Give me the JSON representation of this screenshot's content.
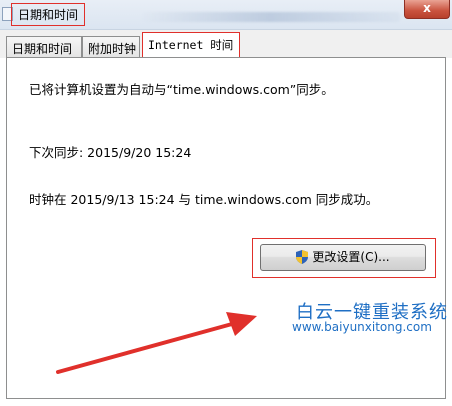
{
  "window": {
    "title": "日期和时间",
    "close_label": "x"
  },
  "tabs": [
    {
      "label": "日期和时间"
    },
    {
      "label": "附加时钟"
    },
    {
      "label": "Internet 时间"
    }
  ],
  "internet_time": {
    "set_sync_text": "已将计算机设置为自动与“time.windows.com”同步。",
    "next_sync_text": "下次同步: 2015/9/20 15:24",
    "last_sync_text": "时钟在 2015/9/13 15:24 与 time.windows.com 同步成功。",
    "change_settings_label": "更改设置(C)..."
  },
  "watermark": {
    "name": "白云一键重装系统",
    "url": "www.baiyunxitong.com"
  },
  "colors": {
    "highlight": "#e0302b",
    "watermark": "#1f6fc4"
  }
}
